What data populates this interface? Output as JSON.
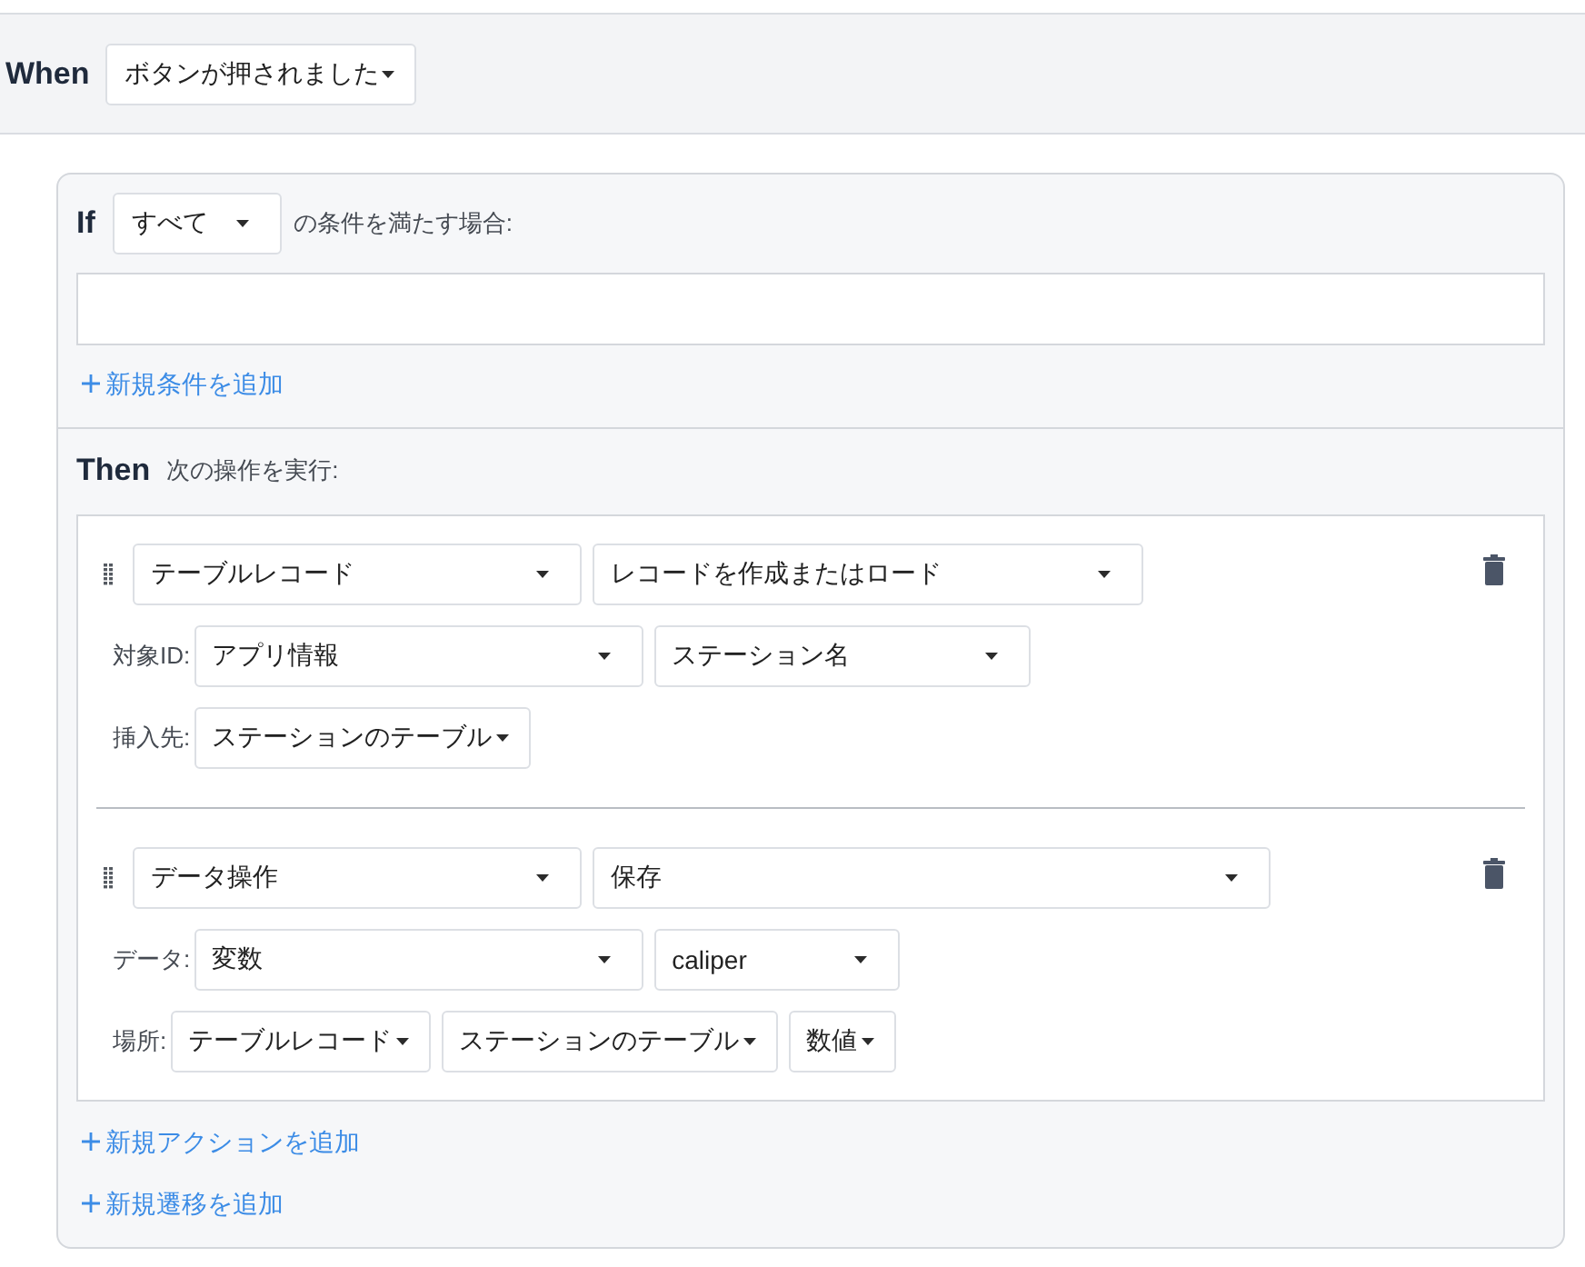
{
  "when": {
    "label": "When",
    "event": {
      "value": "ボタンが押されました",
      "kind": "inline"
    }
  },
  "if": {
    "label": "If",
    "match": {
      "value": "すべて",
      "kind": "block"
    },
    "suffix": "の条件を満たす場合:",
    "add_condition": "新規条件を追加"
  },
  "then": {
    "label": "Then",
    "suffix": "次の操作を実行:",
    "actions": [
      {
        "type": {
          "value": "テーブルレコード",
          "kind": "block"
        },
        "operation": {
          "value": "レコードを作成またはロード",
          "kind": "block"
        },
        "fields": [
          {
            "label": "対象ID:",
            "selects": [
              {
                "value": "アプリ情報",
                "kind": "block"
              },
              {
                "value": "ステーション名",
                "kind": "block"
              }
            ]
          },
          {
            "label": "挿入先:",
            "selects": [
              {
                "value": "ステーションのテーブル",
                "kind": "inline"
              }
            ]
          }
        ]
      },
      {
        "type": {
          "value": "データ操作",
          "kind": "block"
        },
        "operation": {
          "value": "保存",
          "kind": "block"
        },
        "fields": [
          {
            "label": "データ:",
            "selects": [
              {
                "value": "変数",
                "kind": "block"
              },
              {
                "value": "caliper",
                "kind": "block"
              }
            ]
          },
          {
            "label": "場所:",
            "selects": [
              {
                "value": "テーブルレコード",
                "kind": "inline"
              },
              {
                "value": "ステーションのテーブル",
                "kind": "inline"
              },
              {
                "value": "数値",
                "kind": "inline"
              }
            ]
          }
        ]
      }
    ],
    "add_action": "新規アクションを追加",
    "add_transition": "新規遷移を追加"
  }
}
